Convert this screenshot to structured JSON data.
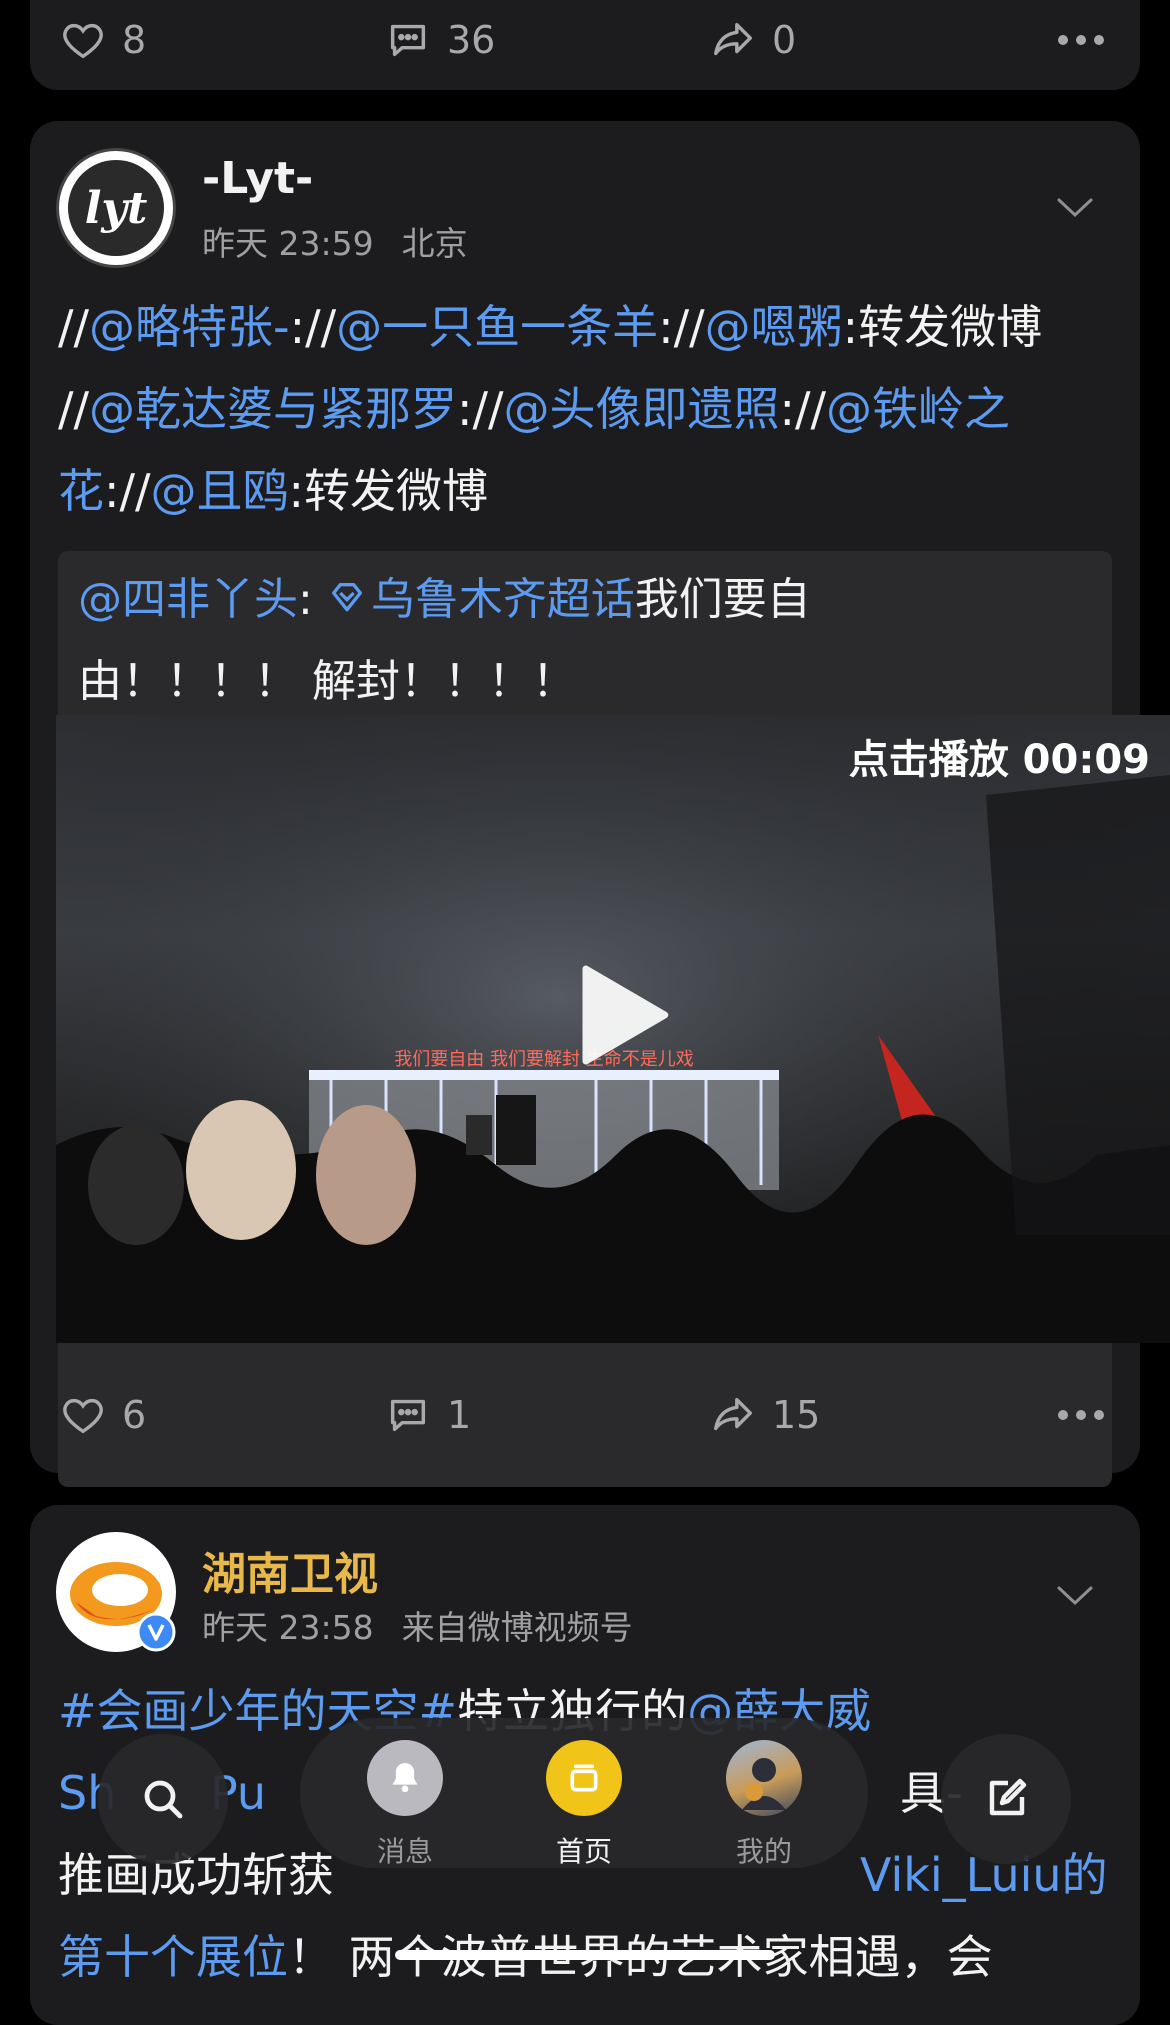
{
  "top_post": {
    "likes": "8",
    "comments": "36",
    "reposts": "0"
  },
  "post1": {
    "username": "-Lyt-",
    "avatar_text": "lyt",
    "time": "昨天 23:59",
    "location": "北京",
    "text_parts": [
      {
        "t": "//",
        "link": false
      },
      {
        "t": "@略特张-",
        "link": true
      },
      {
        "t": "://",
        "link": false
      },
      {
        "t": "@一只鱼一条羊",
        "link": true
      },
      {
        "t": "://",
        "link": false
      },
      {
        "t": "@嗯粥",
        "link": true
      },
      {
        "t": ":转发微博 //",
        "link": false
      },
      {
        "t": "@乾达婆与紧那罗",
        "link": true
      },
      {
        "t": "://",
        "link": false
      },
      {
        "t": "@头像即遗照",
        "link": true
      },
      {
        "t": "://",
        "link": false
      },
      {
        "t": "@铁岭之花",
        "link": true
      },
      {
        "t": "://",
        "link": false
      },
      {
        "t": "@且鸥",
        "link": true
      },
      {
        "t": ":转发微博",
        "link": false
      }
    ],
    "repost": {
      "author": "@四非丫头",
      "separator": ": ",
      "topic": "乌鲁木齐超话",
      "text": "我们要自由！！！！ 解封！！！！"
    },
    "video_label": "点击播放 00:09",
    "video_sign": "我们要自由 我们要解封 生命不是儿戏",
    "likes": "6",
    "comments": "1",
    "reposts": "15"
  },
  "post2": {
    "username": "湖南卫视",
    "username_color": "#e8b94a",
    "time": "昨天 23:58",
    "source": "来自微博视频号",
    "line1_parts": [
      {
        "t": "#会画少年的天空#",
        "link": true
      },
      {
        "t": "特立独行的",
        "link": false
      },
      {
        "t": "@薛大威",
        "link": true
      }
    ],
    "line2_left": "Sh",
    "line2_mid": "Pu",
    "line2_right": "具-",
    "line3_left": "推画成功斩获",
    "line3_right": "Viki_Luiu的",
    "line4_link": "第十个展位",
    "line4_text": "！ 两个波普世界的艺术家相遇，会"
  },
  "nav": {
    "messages": "消息",
    "home": "首页",
    "profile": "我的"
  },
  "colors": {
    "link": "#5c9bf0",
    "active_tab": "#f0c419",
    "card_bg": "#1c1c1e"
  }
}
